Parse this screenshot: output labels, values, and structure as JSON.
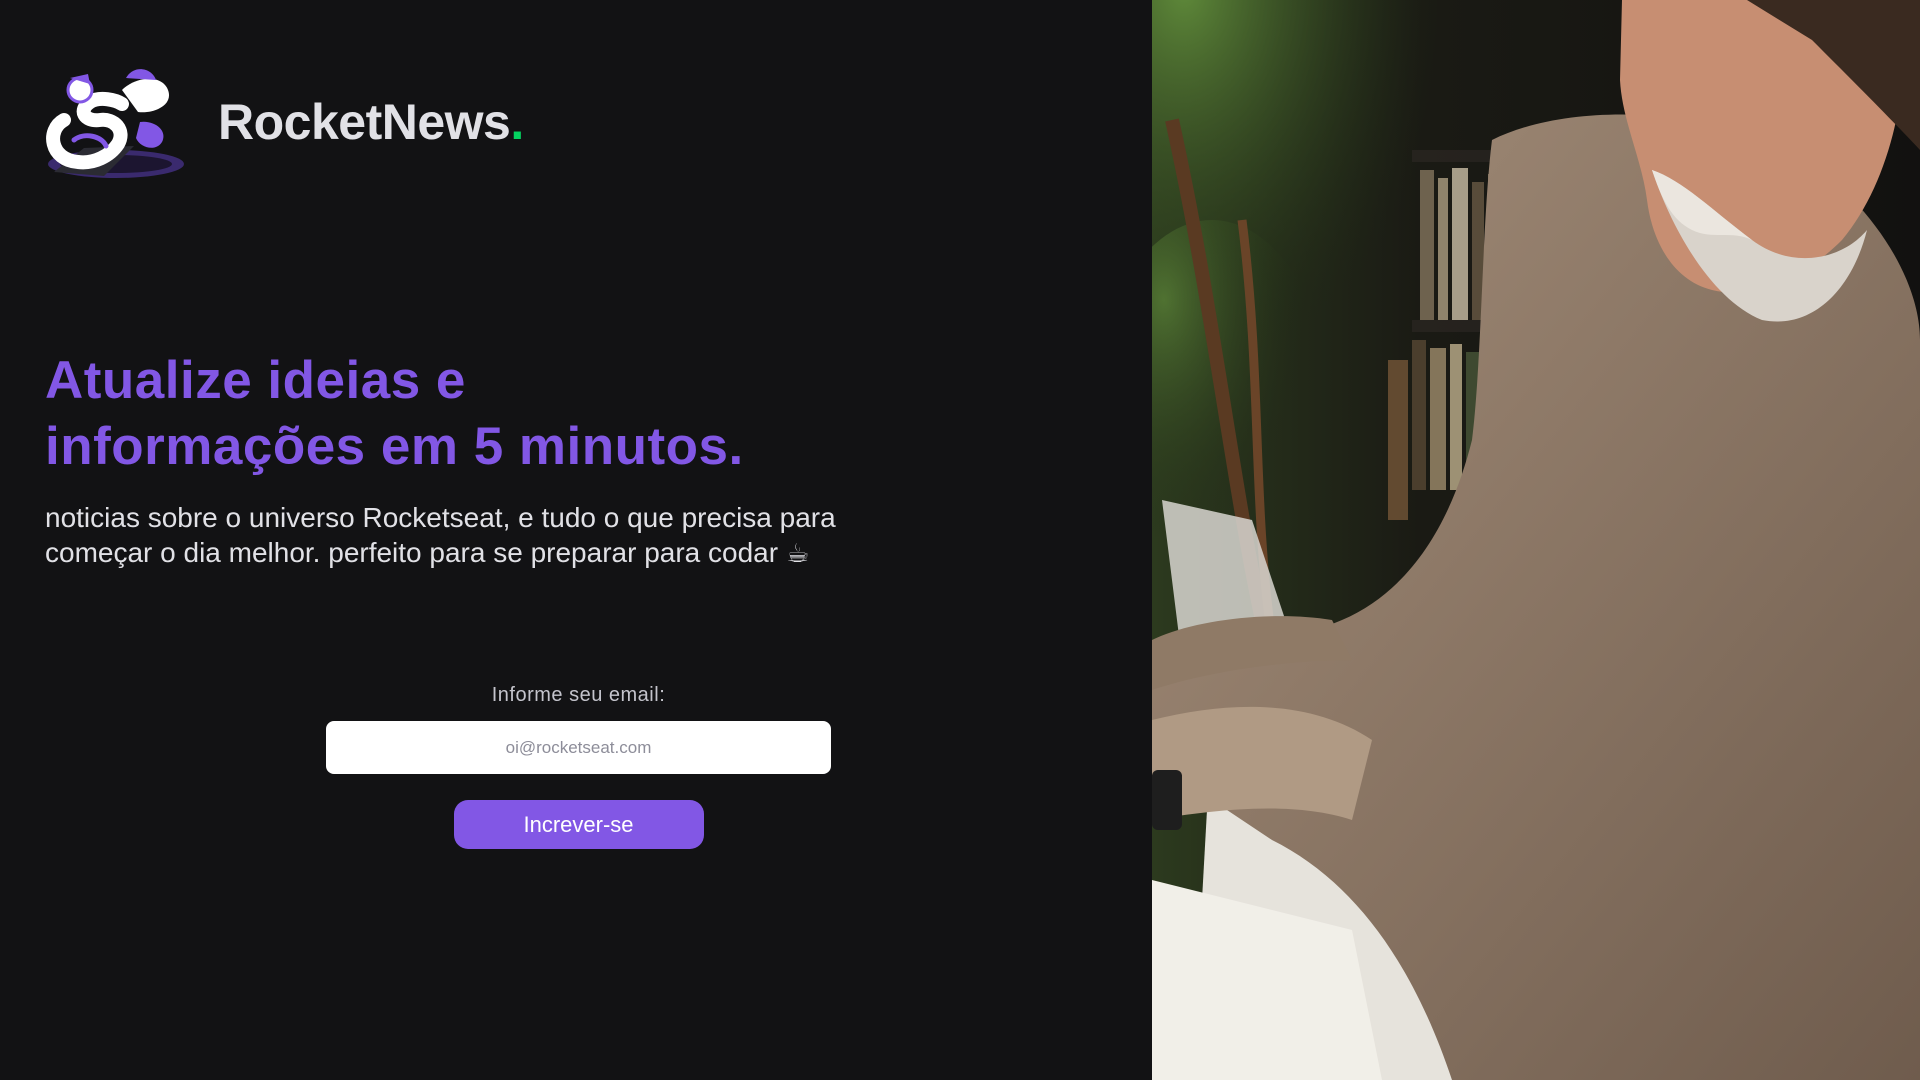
{
  "brand": {
    "name": "RocketNews",
    "dot": ".",
    "accent_color": "#04d361"
  },
  "hero": {
    "headline_line1": "Atualize ideias e",
    "headline_line2": "informações em 5 minutos.",
    "subtitle": "noticias sobre o universo Rocketseat, e tudo o que precisa para começar o dia melhor. perfeito para se preparar para codar",
    "subtitle_emoji": "☕"
  },
  "form": {
    "email_label": "Informe seu email:",
    "email_placeholder": "oi@rocketseat.com",
    "email_value": "",
    "subscribe_label": "Increver-se"
  },
  "colors": {
    "background": "#121214",
    "primary": "#8257e5",
    "text": "#e1e1e6"
  },
  "icons": {
    "logo": "astronaut-mascot-icon",
    "photo": "man-working-at-laptop-photo"
  }
}
